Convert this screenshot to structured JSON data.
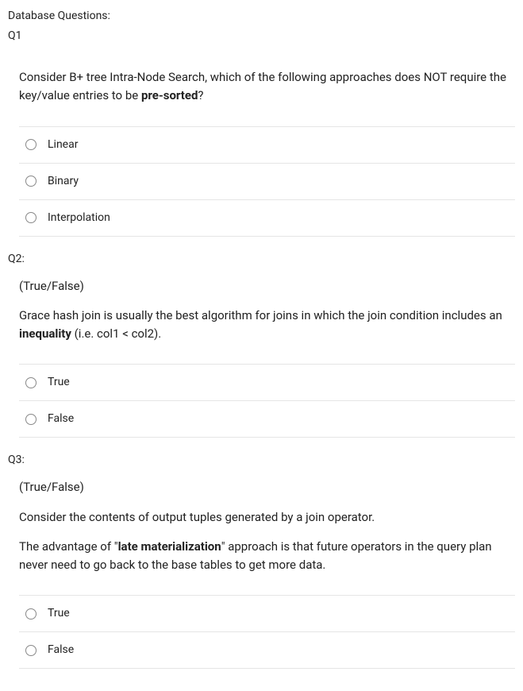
{
  "header": {
    "title": "Database Questions:",
    "q1_label": "Q1"
  },
  "q1": {
    "text_before": "Consider B+ tree Intra-Node Search, which of the following approaches does NOT require the key/value entries to be ",
    "text_bold": "pre-sorted",
    "text_after": "?",
    "options": [
      "Linear",
      "Binary",
      "Interpolation"
    ]
  },
  "q2": {
    "label": "Q2:",
    "tf": "(True/False)",
    "text_before": "Grace hash join is usually the best algorithm for joins in which the join condition includes an ",
    "text_bold": "inequality",
    "text_after": " (i.e. col1 < col2).",
    "options": [
      "True",
      "False"
    ]
  },
  "q3": {
    "label": "Q3:",
    "tf": "(True/False)",
    "p1": "Consider the contents of output tuples generated by a join operator.",
    "p2_before": "The advantage of \"",
    "p2_bold": "late materialization",
    "p2_after": "\" approach is that future operators in the query plan never need to go back to the base tables to get more data.",
    "options": [
      "True",
      "False"
    ]
  }
}
